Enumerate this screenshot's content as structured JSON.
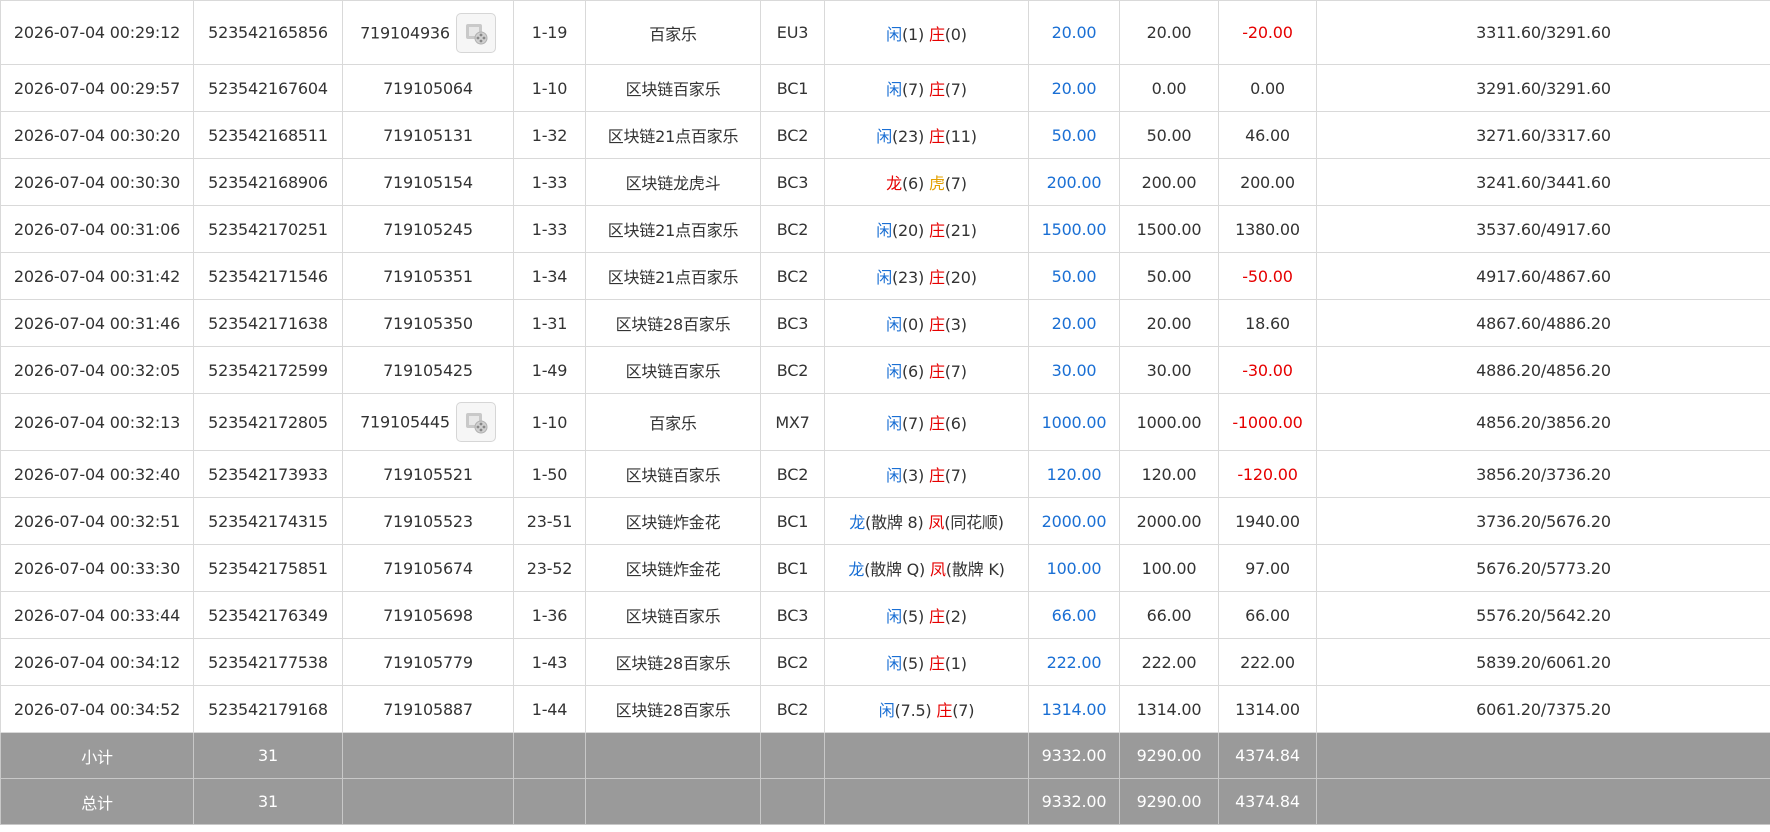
{
  "table": {
    "rows": [
      {
        "time": "2026-07-04 00:29:12",
        "bet_id": "523542165856",
        "round_id": "719104936",
        "has_replay": true,
        "shoe": "1-19",
        "game": "百家乐",
        "table": "EU3",
        "result": [
          {
            "t": "闲",
            "c": "blue"
          },
          {
            "t": "(1) "
          },
          {
            "t": "庄",
            "c": "red"
          },
          {
            "t": "(0)"
          }
        ],
        "bet": "20.00",
        "valid": "20.00",
        "win": "-20.00",
        "win_neg": true,
        "balance": "3311.60/3291.60"
      },
      {
        "time": "2026-07-04 00:29:57",
        "bet_id": "523542167604",
        "round_id": "719105064",
        "has_replay": false,
        "shoe": "1-10",
        "game": "区块链百家乐",
        "table": "BC1",
        "result": [
          {
            "t": "闲",
            "c": "blue"
          },
          {
            "t": "(7) "
          },
          {
            "t": "庄",
            "c": "red"
          },
          {
            "t": "(7)"
          }
        ],
        "bet": "20.00",
        "valid": "0.00",
        "win": "0.00",
        "win_neg": false,
        "balance": "3291.60/3291.60"
      },
      {
        "time": "2026-07-04 00:30:20",
        "bet_id": "523542168511",
        "round_id": "719105131",
        "has_replay": false,
        "shoe": "1-32",
        "game": "区块链21点百家乐",
        "table": "BC2",
        "result": [
          {
            "t": "闲",
            "c": "blue"
          },
          {
            "t": "(23) "
          },
          {
            "t": "庄",
            "c": "red"
          },
          {
            "t": "(11)"
          }
        ],
        "bet": "50.00",
        "valid": "50.00",
        "win": "46.00",
        "win_neg": false,
        "balance": "3271.60/3317.60"
      },
      {
        "time": "2026-07-04 00:30:30",
        "bet_id": "523542168906",
        "round_id": "719105154",
        "has_replay": false,
        "shoe": "1-33",
        "game": "区块链龙虎斗",
        "table": "BC3",
        "result": [
          {
            "t": "龙",
            "c": "red"
          },
          {
            "t": "(6) "
          },
          {
            "t": "虎",
            "c": "gold"
          },
          {
            "t": "(7)"
          }
        ],
        "bet": "200.00",
        "valid": "200.00",
        "win": "200.00",
        "win_neg": false,
        "balance": "3241.60/3441.60"
      },
      {
        "time": "2026-07-04 00:31:06",
        "bet_id": "523542170251",
        "round_id": "719105245",
        "has_replay": false,
        "shoe": "1-33",
        "game": "区块链21点百家乐",
        "table": "BC2",
        "result": [
          {
            "t": "闲",
            "c": "blue"
          },
          {
            "t": "(20) "
          },
          {
            "t": "庄",
            "c": "red"
          },
          {
            "t": "(21)"
          }
        ],
        "bet": "1500.00",
        "valid": "1500.00",
        "win": "1380.00",
        "win_neg": false,
        "balance": "3537.60/4917.60"
      },
      {
        "time": "2026-07-04 00:31:42",
        "bet_id": "523542171546",
        "round_id": "719105351",
        "has_replay": false,
        "shoe": "1-34",
        "game": "区块链21点百家乐",
        "table": "BC2",
        "result": [
          {
            "t": "闲",
            "c": "blue"
          },
          {
            "t": "(23) "
          },
          {
            "t": "庄",
            "c": "red"
          },
          {
            "t": "(20)"
          }
        ],
        "bet": "50.00",
        "valid": "50.00",
        "win": "-50.00",
        "win_neg": true,
        "balance": "4917.60/4867.60"
      },
      {
        "time": "2026-07-04 00:31:46",
        "bet_id": "523542171638",
        "round_id": "719105350",
        "has_replay": false,
        "shoe": "1-31",
        "game": "区块链28百家乐",
        "table": "BC3",
        "result": [
          {
            "t": "闲",
            "c": "blue"
          },
          {
            "t": "(0) "
          },
          {
            "t": "庄",
            "c": "red"
          },
          {
            "t": "(3)"
          }
        ],
        "bet": "20.00",
        "valid": "20.00",
        "win": "18.60",
        "win_neg": false,
        "balance": "4867.60/4886.20"
      },
      {
        "time": "2026-07-04 00:32:05",
        "bet_id": "523542172599",
        "round_id": "719105425",
        "has_replay": false,
        "shoe": "1-49",
        "game": "区块链百家乐",
        "table": "BC2",
        "result": [
          {
            "t": "闲",
            "c": "blue"
          },
          {
            "t": "(6) "
          },
          {
            "t": "庄",
            "c": "red"
          },
          {
            "t": "(7)"
          }
        ],
        "bet": "30.00",
        "valid": "30.00",
        "win": "-30.00",
        "win_neg": true,
        "balance": "4886.20/4856.20"
      },
      {
        "time": "2026-07-04 00:32:13",
        "bet_id": "523542172805",
        "round_id": "719105445",
        "has_replay": true,
        "shoe": "1-10",
        "game": "百家乐",
        "table": "MX7",
        "result": [
          {
            "t": "闲",
            "c": "blue"
          },
          {
            "t": "(7) "
          },
          {
            "t": "庄",
            "c": "red"
          },
          {
            "t": "(6)"
          }
        ],
        "bet": "1000.00",
        "valid": "1000.00",
        "win": "-1000.00",
        "win_neg": true,
        "balance": "4856.20/3856.20"
      },
      {
        "time": "2026-07-04 00:32:40",
        "bet_id": "523542173933",
        "round_id": "719105521",
        "has_replay": false,
        "shoe": "1-50",
        "game": "区块链百家乐",
        "table": "BC2",
        "result": [
          {
            "t": "闲",
            "c": "blue"
          },
          {
            "t": "(3) "
          },
          {
            "t": "庄",
            "c": "red"
          },
          {
            "t": "(7)"
          }
        ],
        "bet": "120.00",
        "valid": "120.00",
        "win": "-120.00",
        "win_neg": true,
        "balance": "3856.20/3736.20"
      },
      {
        "time": "2026-07-04 00:32:51",
        "bet_id": "523542174315",
        "round_id": "719105523",
        "has_replay": false,
        "shoe": "23-51",
        "game": "区块链炸金花",
        "table": "BC1",
        "result": [
          {
            "t": "龙",
            "c": "blue"
          },
          {
            "t": "(散牌 8) "
          },
          {
            "t": "凤",
            "c": "red"
          },
          {
            "t": "(同花顺)"
          }
        ],
        "bet": "2000.00",
        "valid": "2000.00",
        "win": "1940.00",
        "win_neg": false,
        "balance": "3736.20/5676.20"
      },
      {
        "time": "2026-07-04 00:33:30",
        "bet_id": "523542175851",
        "round_id": "719105674",
        "has_replay": false,
        "shoe": "23-52",
        "game": "区块链炸金花",
        "table": "BC1",
        "result": [
          {
            "t": "龙",
            "c": "blue"
          },
          {
            "t": "(散牌 Q) "
          },
          {
            "t": "凤",
            "c": "red"
          },
          {
            "t": "(散牌 K)"
          }
        ],
        "bet": "100.00",
        "valid": "100.00",
        "win": "97.00",
        "win_neg": false,
        "balance": "5676.20/5773.20"
      },
      {
        "time": "2026-07-04 00:33:44",
        "bet_id": "523542176349",
        "round_id": "719105698",
        "has_replay": false,
        "shoe": "1-36",
        "game": "区块链百家乐",
        "table": "BC3",
        "result": [
          {
            "t": "闲",
            "c": "blue"
          },
          {
            "t": "(5) "
          },
          {
            "t": "庄",
            "c": "red"
          },
          {
            "t": "(2)"
          }
        ],
        "bet": "66.00",
        "valid": "66.00",
        "win": "66.00",
        "win_neg": false,
        "balance": "5576.20/5642.20"
      },
      {
        "time": "2026-07-04 00:34:12",
        "bet_id": "523542177538",
        "round_id": "719105779",
        "has_replay": false,
        "shoe": "1-43",
        "game": "区块链28百家乐",
        "table": "BC2",
        "result": [
          {
            "t": "闲",
            "c": "blue"
          },
          {
            "t": "(5) "
          },
          {
            "t": "庄",
            "c": "red"
          },
          {
            "t": "(1)"
          }
        ],
        "bet": "222.00",
        "valid": "222.00",
        "win": "222.00",
        "win_neg": false,
        "balance": "5839.20/6061.20"
      },
      {
        "time": "2026-07-04 00:34:52",
        "bet_id": "523542179168",
        "round_id": "719105887",
        "has_replay": false,
        "shoe": "1-44",
        "game": "区块链28百家乐",
        "table": "BC2",
        "result": [
          {
            "t": "闲",
            "c": "blue"
          },
          {
            "t": "(7.5) "
          },
          {
            "t": "庄",
            "c": "red"
          },
          {
            "t": "(7)"
          }
        ],
        "bet": "1314.00",
        "valid": "1314.00",
        "win": "1314.00",
        "win_neg": false,
        "balance": "6061.20/7375.20"
      }
    ],
    "summary": [
      {
        "label": "小计",
        "count": "31",
        "bet": "9332.00",
        "valid": "9290.00",
        "win": "4374.84"
      },
      {
        "label": "总计",
        "count": "31",
        "bet": "9332.00",
        "valid": "9290.00",
        "win": "4374.84"
      }
    ]
  },
  "icons": {
    "replay": "video-replay-icon"
  },
  "colors": {
    "blue": "#1a6fd4",
    "red": "#e60000",
    "gold": "#e3a000",
    "summary_bg": "#9a9a9a"
  }
}
